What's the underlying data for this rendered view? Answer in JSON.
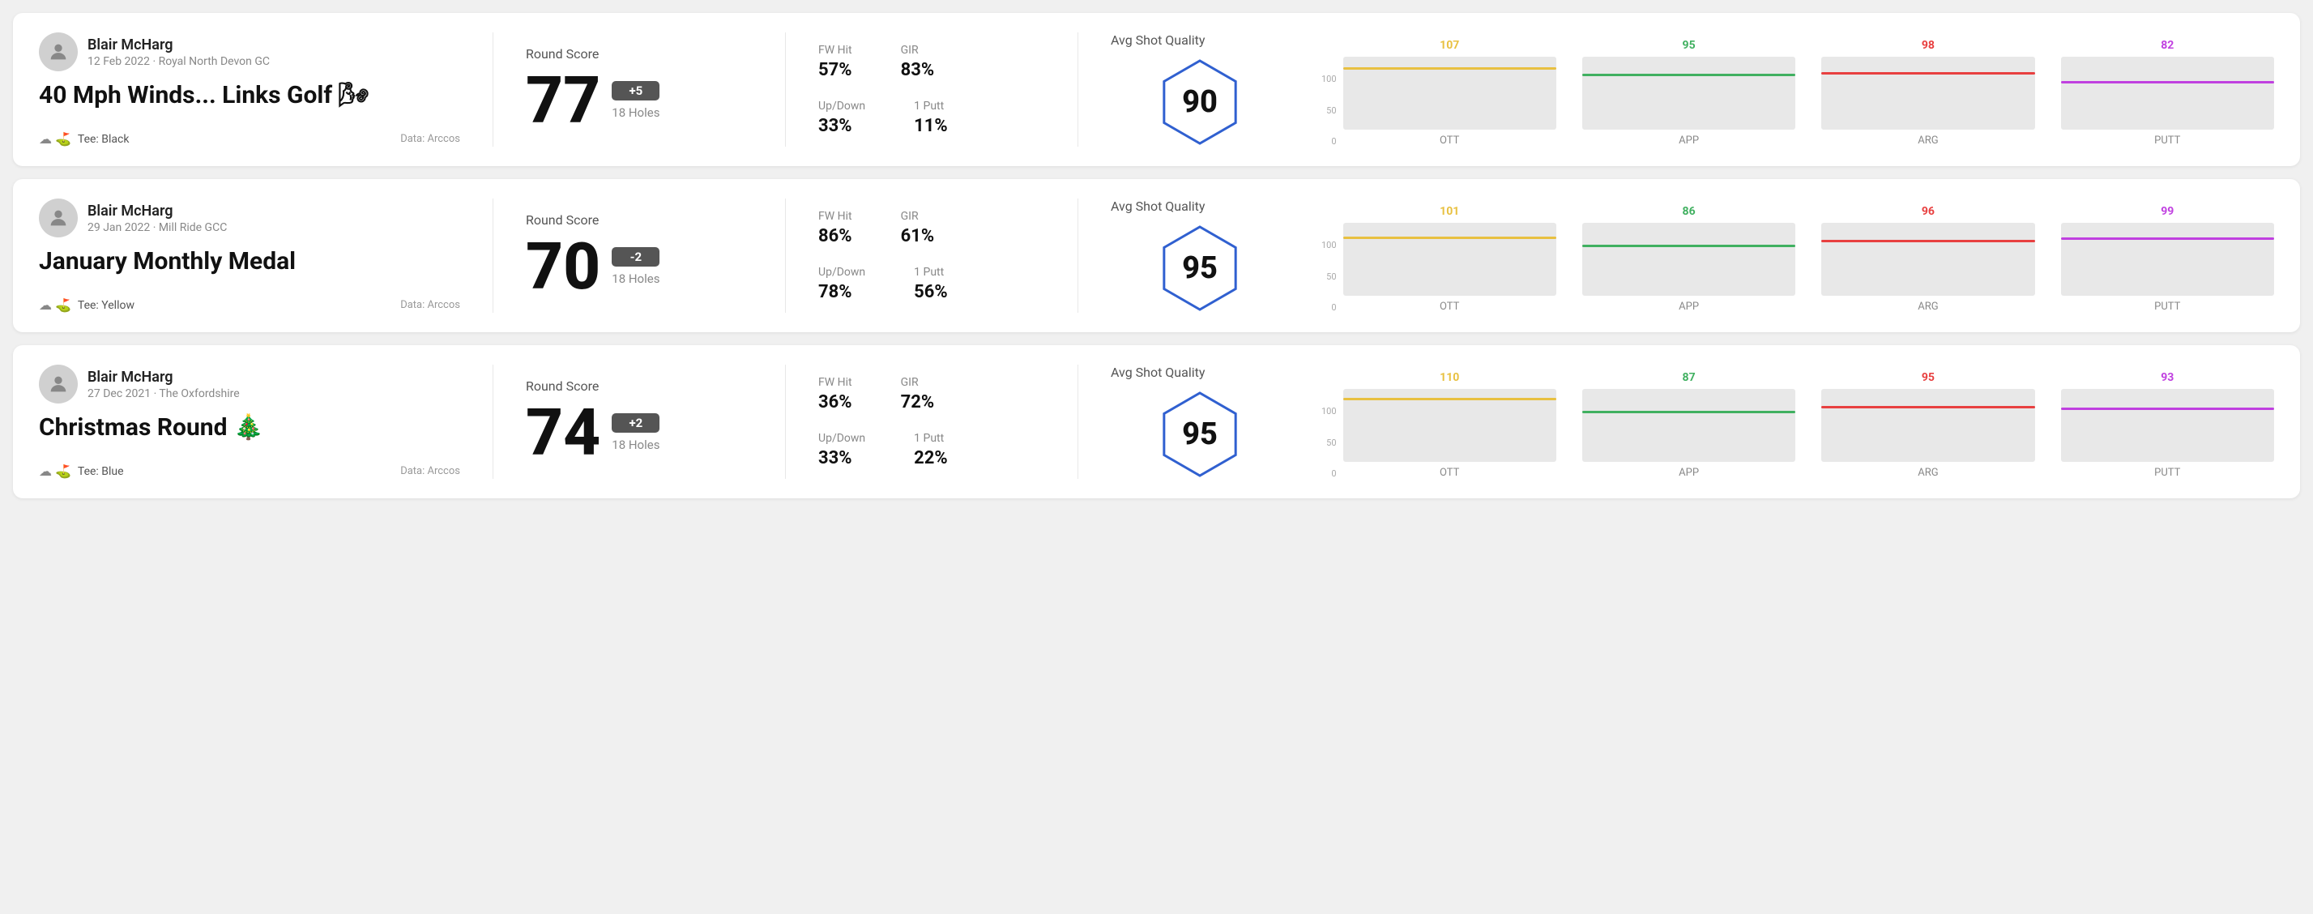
{
  "rounds": [
    {
      "id": "round1",
      "user_name": "Blair McHarg",
      "user_date": "12 Feb 2022 · Royal North Devon GC",
      "title": "40 Mph Winds... Links Golf 🌬",
      "tee": "Tee: Black",
      "data_source": "Data: Arccos",
      "score": "77",
      "score_diff": "+5",
      "score_diff_type": "pos",
      "holes": "18 Holes",
      "fw_hit": "57%",
      "gir": "83%",
      "up_down": "33%",
      "one_putt": "11%",
      "avg_quality": "90",
      "chart": {
        "bars": [
          {
            "label": "OTT",
            "value": 107,
            "color": "#e8c040",
            "max": 130
          },
          {
            "label": "APP",
            "value": 95,
            "color": "#40b060",
            "max": 130
          },
          {
            "label": "ARG",
            "value": 98,
            "color": "#e84040",
            "max": 130
          },
          {
            "label": "PUTT",
            "value": 82,
            "color": "#c040e0",
            "max": 130
          }
        ]
      }
    },
    {
      "id": "round2",
      "user_name": "Blair McHarg",
      "user_date": "29 Jan 2022 · Mill Ride GCC",
      "title": "January Monthly Medal",
      "tee": "Tee: Yellow",
      "data_source": "Data: Arccos",
      "score": "70",
      "score_diff": "-2",
      "score_diff_type": "neg",
      "holes": "18 Holes",
      "fw_hit": "86%",
      "gir": "61%",
      "up_down": "78%",
      "one_putt": "56%",
      "avg_quality": "95",
      "chart": {
        "bars": [
          {
            "label": "OTT",
            "value": 101,
            "color": "#e8c040",
            "max": 130
          },
          {
            "label": "APP",
            "value": 86,
            "color": "#40b060",
            "max": 130
          },
          {
            "label": "ARG",
            "value": 96,
            "color": "#e84040",
            "max": 130
          },
          {
            "label": "PUTT",
            "value": 99,
            "color": "#c040e0",
            "max": 130
          }
        ]
      }
    },
    {
      "id": "round3",
      "user_name": "Blair McHarg",
      "user_date": "27 Dec 2021 · The Oxfordshire",
      "title": "Christmas Round 🎄",
      "tee": "Tee: Blue",
      "data_source": "Data: Arccos",
      "score": "74",
      "score_diff": "+2",
      "score_diff_type": "pos",
      "holes": "18 Holes",
      "fw_hit": "36%",
      "gir": "72%",
      "up_down": "33%",
      "one_putt": "22%",
      "avg_quality": "95",
      "chart": {
        "bars": [
          {
            "label": "OTT",
            "value": 110,
            "color": "#e8c040",
            "max": 130
          },
          {
            "label": "APP",
            "value": 87,
            "color": "#40b060",
            "max": 130
          },
          {
            "label": "ARG",
            "value": 95,
            "color": "#e84040",
            "max": 130
          },
          {
            "label": "PUTT",
            "value": 93,
            "color": "#c040e0",
            "max": 130
          }
        ]
      }
    }
  ],
  "labels": {
    "round_score": "Round Score",
    "fw_hit": "FW Hit",
    "gir": "GIR",
    "up_down": "Up/Down",
    "one_putt": "1 Putt",
    "avg_shot_quality": "Avg Shot Quality",
    "data_arccos": "Data: Arccos",
    "y_axis_100": "100",
    "y_axis_50": "50",
    "y_axis_0": "0"
  }
}
